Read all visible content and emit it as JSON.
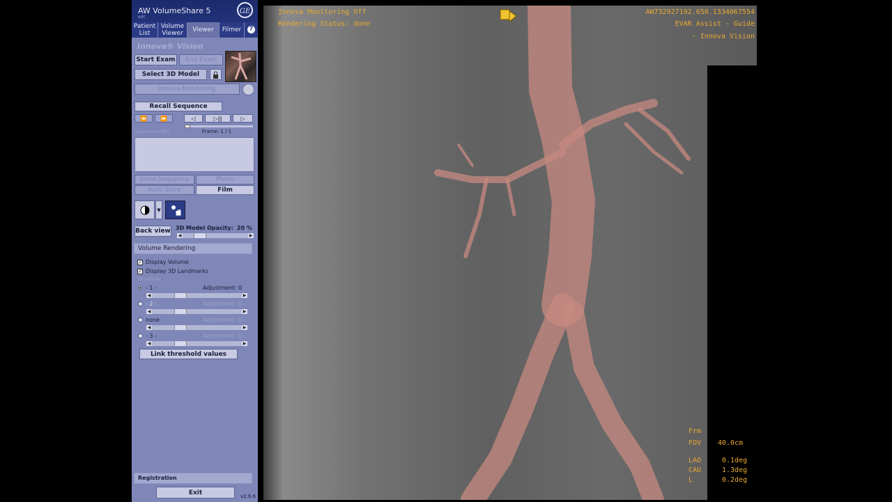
{
  "app": {
    "title": "AW VolumeShare 5",
    "subtitle": "edc",
    "logo_text": "GE"
  },
  "tabs": [
    "Patient List",
    "Volume Viewer",
    "Viewer",
    "Filmer"
  ],
  "help_label": "?",
  "panel": {
    "heading": "Innova® Vision",
    "start_exam": "Start Exam",
    "end_exam": "End Exam",
    "select_3d_model": "Select 3D Model",
    "innova_monitoring": "Innova Monitoring",
    "recall_sequence": "Recall Sequence",
    "frame_label": "Frame:  1 / 1",
    "sequence_buffer_label": "Sequence buffer",
    "store_sequence": "Store Sequence",
    "photo": "Photo",
    "auto_store": "Auto Store",
    "film": "Film",
    "back_view": "Back view",
    "opacity_label": "3D Model Opacity:",
    "opacity_value": "20 %",
    "opacity_fraction": 0.2,
    "volume_rendering": "Volume Rendering",
    "display_volume": "Display Volume",
    "display_landmarks": "Display 3D Landmarks",
    "thresholds_label": "Thresholds",
    "thresholds": [
      {
        "name": "- 1 -",
        "adjustment": "Adjustment: 0",
        "selected": true,
        "enabled": true
      },
      {
        "name": "- 2 -",
        "adjustment": "Adjustment: 0",
        "selected": false,
        "enabled": false
      },
      {
        "name": "none",
        "adjustment": "Adjustment: 0",
        "selected": false,
        "enabled": false
      },
      {
        "name": "- 3 -",
        "adjustment": "Adjustment: 0",
        "selected": false,
        "enabled": false
      }
    ],
    "link_threshold": "Link threshold values",
    "registration": "Registration",
    "exit": "Exit",
    "version": "v2.6.6"
  },
  "overlay": {
    "monitoring": "Innova Monitoring Off",
    "rendering_status": "Rendering Status: done",
    "study_id": "AW732927192.650.1334067554",
    "protocol": "EVAR Assist - Guide",
    "app_name": "- Innova Vision",
    "frm": "Frm",
    "fov_label": "FOV",
    "fov_value": "40.0cm",
    "lao_label": "LAO",
    "lao_value": "0.1deg",
    "cau_label": "CAU",
    "cau_value": "1.3deg",
    "l_label": "L",
    "l_value": "0.2deg"
  },
  "colors": {
    "panel_bg": "#7f87b8",
    "titlebar_bg": "#1a2a6a",
    "overlay_text": "#e9a931",
    "vessel_overlay": "#c78a80"
  }
}
